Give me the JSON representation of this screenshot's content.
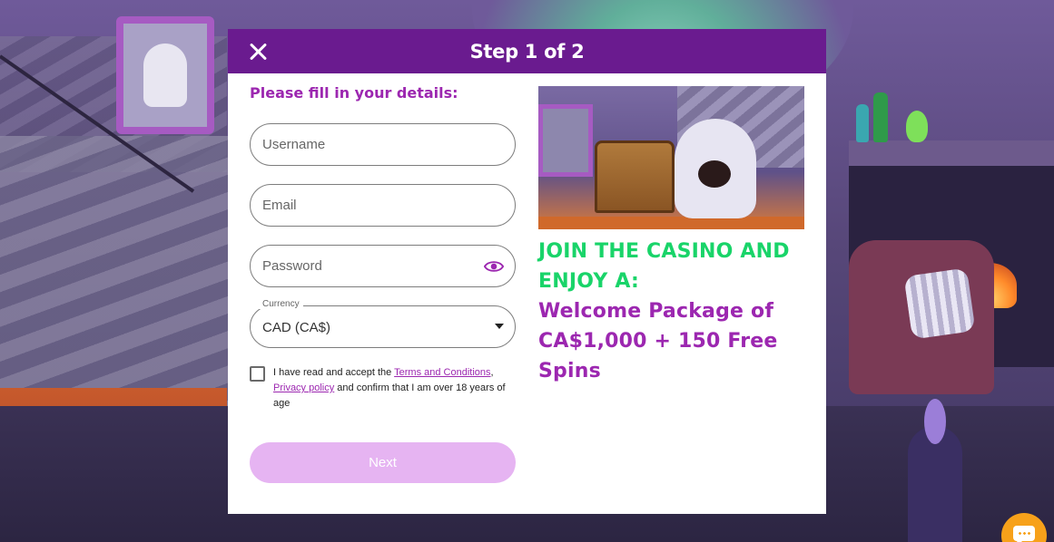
{
  "modal": {
    "title": "Step 1 of 2",
    "form_heading": "Please fill in your details:"
  },
  "fields": {
    "username": {
      "placeholder": "Username",
      "value": ""
    },
    "email": {
      "placeholder": "Email",
      "value": ""
    },
    "password": {
      "placeholder": "Password",
      "value": ""
    },
    "currency": {
      "label": "Currency",
      "selected": "CAD (CA$)"
    }
  },
  "consent": {
    "prefix": "I have read and accept the ",
    "terms_link": "Terms and Conditions",
    "separator": ",",
    "privacy_link": "Privacy policy",
    "suffix": " and confirm that I am over 18 years of age",
    "checked": false
  },
  "buttons": {
    "next": "Next"
  },
  "promo": {
    "line1": "JOIN THE CASINO AND",
    "line2": "ENJOY A:",
    "line3": "Welcome Package of",
    "line4": "CA$1,000 + 150 Free",
    "line5": "Spins"
  },
  "icons": {
    "close": "close-icon",
    "password_toggle": "eye-icon",
    "currency_caret": "caret-down-icon",
    "chat": "chat-icon"
  },
  "colors": {
    "header_bg": "#6a1b8f",
    "accent_purple": "#9c27b0",
    "accent_green": "#19d469",
    "next_button_disabled": "#e6b4f2",
    "chat_button": "#f7a11a"
  }
}
